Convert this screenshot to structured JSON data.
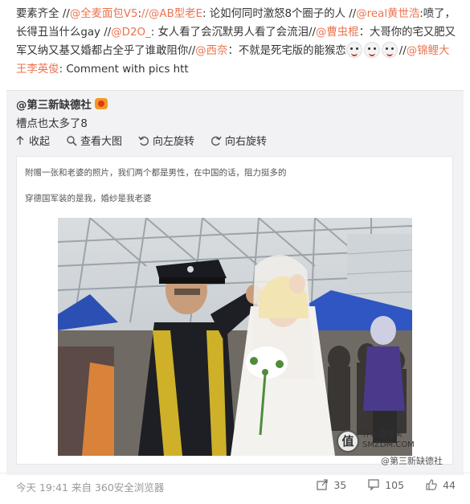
{
  "repost": {
    "t1": "要素齐全 //",
    "m1": "@全麦面包V5",
    "t2": ":",
    "m2": "//@AB型老E",
    "t3": ": 论如何同时激怒8个圈子的人 //",
    "m3": "@real黄世浩",
    "t4": ":喷了，长得丑当什么gay //",
    "m4": "@D2O_",
    "t5": ": 女人看了会沉默男人看了会流泪//",
    "m5": "@曹虫棍",
    "t6": "：大哥你的宅又肥又军又纳又基又婚都占全乎了谁敢阻你//",
    "m6": "@西奈",
    "t7": "：不就是死宅版的能猴恋",
    "t8": "//",
    "m7": "@锦鲤大王李英俊",
    "t9": ": Comment with pics htt"
  },
  "original": {
    "author": "@第三新缺德社",
    "text": "槽点也太多了8"
  },
  "toolbar": {
    "collapse": "收起",
    "view_large": "查看大图",
    "rotate_left": "向左旋转",
    "rotate_right": "向右旋转"
  },
  "photo": {
    "caption1": "附赠一张和老婆的照片，我们两个都是男性，在中国的话，阻力挺多的",
    "caption2": "穿德国军装的是我，婚纱是我老婆",
    "watermark_line1": "什么值得买",
    "watermark_line2": "SMZDM.COM",
    "weibo_watermark": "@第三新缺德社"
  },
  "footer": {
    "timestamp": "今天 19:41 来自 360安全浏览器",
    "reposts": "35",
    "comments": "105",
    "likes": "44"
  },
  "colors": {
    "mention": "#eb7350",
    "card_bg": "#f2f2f5"
  }
}
